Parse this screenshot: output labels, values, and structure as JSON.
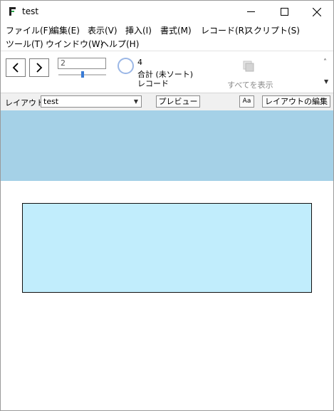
{
  "window": {
    "title": "test",
    "controls": {
      "minimize": "minimize",
      "maximize": "maximize",
      "close": "close"
    }
  },
  "menu": {
    "row1": [
      "ファイル(F)",
      "編集(E)",
      "表示(V)",
      "挿入(I)",
      "書式(M)",
      "レコード(R)",
      "スクリプト(S)"
    ],
    "row2": [
      "ツール(T)",
      "ウインドウ(W)",
      "ヘルプ(H)"
    ]
  },
  "toolbar": {
    "record_number": "2",
    "found_count": "4",
    "total_label": "合計 (未ソート)",
    "records_label": "レコード",
    "show_all_label": "すべてを表示",
    "record_slider_fraction": 0.5
  },
  "layout_bar": {
    "layout_label": "レイアウト:",
    "layout_value": "test",
    "preview_label": "プレビュー",
    "format_label": "Aa",
    "edit_layout_label": "レイアウトの編集"
  },
  "colors": {
    "header_part": "#a5d1e7",
    "rectangle_fill": "#c1edfc",
    "accent": "#3a7bd5"
  },
  "icons": {
    "app": "filemaker-app-icon",
    "prev": "chevron-left-icon",
    "next": "chevron-right-icon",
    "pie": "pie-chart-icon",
    "show_all": "show-all-records-icon",
    "collapse": "double-chevron-up-icon",
    "expand": "triangle-down-icon"
  }
}
